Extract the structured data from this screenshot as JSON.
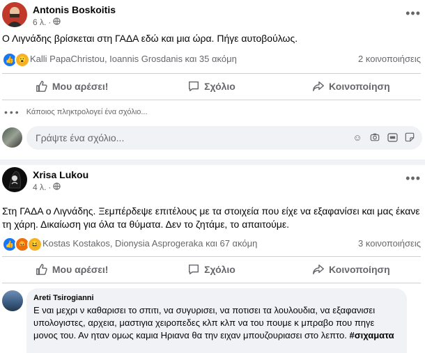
{
  "post1": {
    "author": "Antonis Boskoitis",
    "time": "6 λ.",
    "text": "Ο Λιγνάδης βρίσκεται στη ΓΑΔΑ εδώ και μια ώρα. Πήγε αυτοβούλως.",
    "reaction_names": "Kalli PapaChristou, Ioannis Grosdanis και 35 ακόμη",
    "shares": "2 κοινοποιήσεις",
    "reaction_icons": [
      "like-icon",
      "wow-icon"
    ]
  },
  "actions": {
    "like": "Μου αρέσει!",
    "comment": "Σχόλιο",
    "share": "Κοινοποίηση"
  },
  "typing_text": "Κάποιος πληκτρολογεί ένα σχόλιο...",
  "comment_input": {
    "placeholder": "Γράψτε ένα σχόλιο..."
  },
  "post2": {
    "author": "Xrisa Lukou",
    "time": "4 λ.",
    "text": "Στη ΓΑΔΑ ο Λιγνάδης. Ξεμπέρδεψε επιτέλους με τα στοιχεία που είχε να εξαφανίσει και μας έκανε τη χάρη. Δικαίωση για όλα τα θύματα. Δεν το ζητάμε, το απαιτούμε.",
    "reaction_names": "Kostas Kostakos, Dionysia Asprogeraka και 67 ακόμη",
    "shares": "3 κοινοποιήσεις",
    "reaction_icons": [
      "like-icon",
      "angry-icon",
      "haha-icon"
    ]
  },
  "comment": {
    "author": "Areti Tsirogianni",
    "text": "Ε ναι μεχρι ν καθαρισει το σπιτι, να συγυρισει, να ποτισει τα λουλουδια, να εξαφανισει υπολογιστες, αρχεια, μαστιγια χειροπεδες κλπ κλπ να του πουμε κ μπραβο που πηγε μονος του. Αν ηταν ομως καμια Ηριανα θα την ειχαν μπουζουριασει στο λεπτο.",
    "hashtag": "#σιχαματα"
  },
  "colors": {
    "like": "#1877f2",
    "wow": "#f7b125",
    "angry": "#e9710f",
    "text_secondary": "#65676b",
    "background": "#f0f2f5"
  }
}
